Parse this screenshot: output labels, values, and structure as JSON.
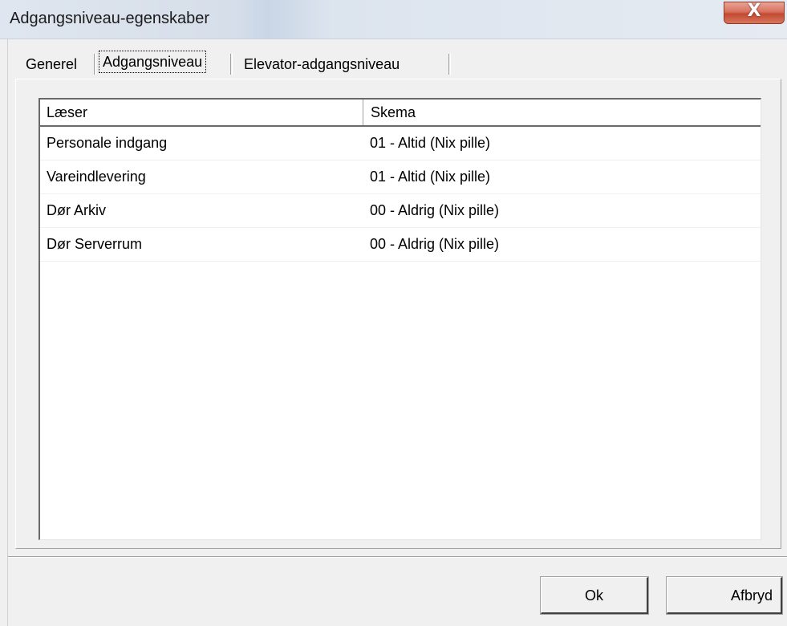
{
  "window": {
    "title": "Adgangsniveau-egenskaber",
    "close_glyph": "X"
  },
  "tabs": [
    {
      "label": "Generel",
      "active": false
    },
    {
      "label": "Adgangsniveau",
      "active": true
    },
    {
      "label": "Elevator-adgangsniveau",
      "active": false
    }
  ],
  "list": {
    "columns": [
      "Læser",
      "Skema"
    ],
    "rows": [
      {
        "reader": "Personale indgang",
        "schedule": "01 - Altid (Nix pille)"
      },
      {
        "reader": "Vareindlevering",
        "schedule": "01 - Altid (Nix pille)"
      },
      {
        "reader": "Dør Arkiv",
        "schedule": "00 - Aldrig (Nix pille)"
      },
      {
        "reader": "Dør Serverrum",
        "schedule": "00 - Aldrig (Nix pille)"
      }
    ]
  },
  "buttons": {
    "ok_label": "Ok",
    "cancel_label": "Afbryd"
  },
  "colors": {
    "close_button": "#c24a32",
    "dialog_background": "#f0f0f0"
  }
}
